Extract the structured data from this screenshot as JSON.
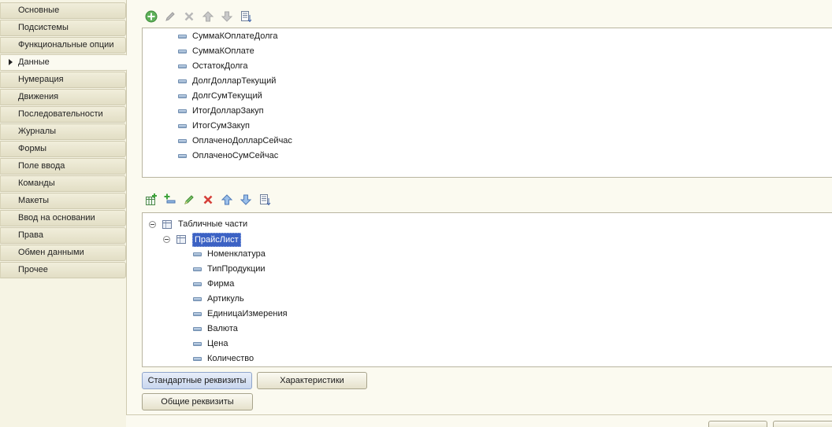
{
  "sidebar": {
    "items": [
      {
        "label": "Основные",
        "active": false
      },
      {
        "label": "Подсистемы",
        "active": false
      },
      {
        "label": "Функциональные опции",
        "active": false
      },
      {
        "label": "Данные",
        "active": true
      },
      {
        "label": "Нумерация",
        "active": false
      },
      {
        "label": "Движения",
        "active": false
      },
      {
        "label": "Последовательности",
        "active": false
      },
      {
        "label": "Журналы",
        "active": false
      },
      {
        "label": "Формы",
        "active": false
      },
      {
        "label": "Поле ввода",
        "active": false
      },
      {
        "label": "Команды",
        "active": false
      },
      {
        "label": "Макеты",
        "active": false
      },
      {
        "label": "Ввод на основании",
        "active": false
      },
      {
        "label": "Права",
        "active": false
      },
      {
        "label": "Обмен данными",
        "active": false
      },
      {
        "label": "Прочее",
        "active": false
      }
    ]
  },
  "toolbar_top": {
    "icons": [
      "add-icon",
      "edit-icon",
      "delete-icon",
      "move-up-icon",
      "move-down-icon",
      "sort-icon"
    ]
  },
  "attributes": {
    "items": [
      "СуммаКОплатеДолга",
      "СуммаКОплате",
      "ОстатокДолга",
      "ДолгДолларТекущий",
      "ДолгСумТекущий",
      "ИтогДолларЗакуп",
      "ИтогСумЗакуп",
      "ОплаченоДолларСейчас",
      "ОплаченоСумСейчас"
    ]
  },
  "toolbar_bottom": {
    "icons": [
      "add-table-icon",
      "add-attribute-icon",
      "edit-icon",
      "delete-icon",
      "move-up-icon",
      "move-down-icon",
      "sort-icon"
    ]
  },
  "tabular": {
    "root_label": "Табличные части",
    "table_label": "ПрайсЛист",
    "columns": [
      "Номенклатура",
      "ТипПродукции",
      "Фирма",
      "Артикуль",
      "ЕдиницаИзмерения",
      "Валюта",
      "Цена",
      "Количество"
    ]
  },
  "buttons": {
    "standard_attributes": "Стандартные реквизиты",
    "characteristics": "Характеристики",
    "common_attributes": "Общие реквизиты"
  },
  "colors": {
    "accent": "#3c62c4",
    "background": "#fbfaf0",
    "sidebar_tab": "#e2dec5"
  }
}
